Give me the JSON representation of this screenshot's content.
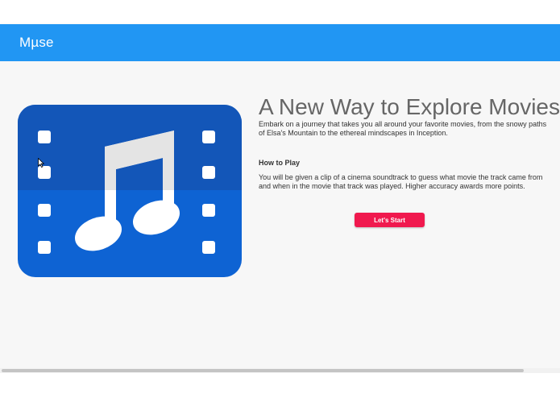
{
  "app": {
    "title": "Mµse"
  },
  "hero": {
    "headline": "A New Way to Explore Movies",
    "intro": "Embark on a journey that takes you all around your favorite movies, from the snowy paths of Elsa's Mountain to the ethereal mindscapes in Inception.",
    "how_to_play": {
      "heading": "How to Play",
      "text": "You will be given a clip of a cinema soundtrack to guess what movie the track came from and when in the movie that track was played. Higher accuracy awards more points."
    },
    "start_button_label": "Let's Start"
  },
  "logo": {
    "icon": "film-music-note-icon",
    "colors": {
      "film_upper": "#1565c0",
      "film_lower": "#0e63d3",
      "holes": "#ffffff",
      "note": "#ffffff",
      "note_highlight": "#e6e6e6"
    }
  },
  "colors": {
    "topbar": "#2196f3",
    "accent_button": "#f0194e",
    "page_background": "#f7f7f7",
    "headline_text": "#666666"
  }
}
